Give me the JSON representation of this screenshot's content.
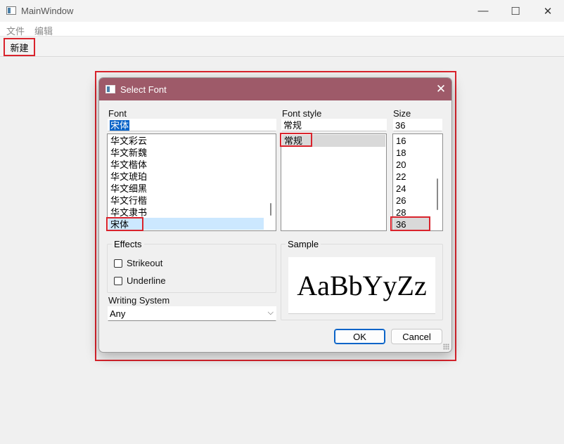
{
  "window": {
    "title": "MainWindow",
    "min_glyph": "—",
    "max_glyph": "☐",
    "close_glyph": "✕"
  },
  "menu": [
    "文件",
    "编辑"
  ],
  "toolbar": {
    "new_label": "新建"
  },
  "dialog": {
    "title": "Select Font",
    "close_glyph": "✕",
    "font": {
      "label": "Font",
      "value": "宋体",
      "items": [
        "华文彩云",
        "华文新魏",
        "华文楷体",
        "华文琥珀",
        "华文细黑",
        "华文行楷",
        "华文隶书",
        "宋体"
      ],
      "selected": "宋体"
    },
    "style": {
      "label": "Font style",
      "value": "常规",
      "items": [
        "常规"
      ],
      "selected": "常规"
    },
    "size": {
      "label": "Size",
      "value": "36",
      "items": [
        "16",
        "18",
        "20",
        "22",
        "24",
        "26",
        "28",
        "36"
      ],
      "selected": "36"
    },
    "effects": {
      "title": "Effects",
      "strikeout": "Strikeout",
      "underline": "Underline",
      "strikeout_checked": false,
      "underline_checked": false
    },
    "writing_system": {
      "label": "Writing System",
      "value": "Any"
    },
    "sample": {
      "title": "Sample",
      "text": "AaBbYyZz"
    },
    "ok_label": "OK",
    "cancel_label": "Cancel"
  },
  "colors": {
    "dialog_titlebar": "#9e5a69",
    "annotation": "#d9232c",
    "selection": "#0a64c8",
    "list_highlight": "#cce8ff"
  }
}
